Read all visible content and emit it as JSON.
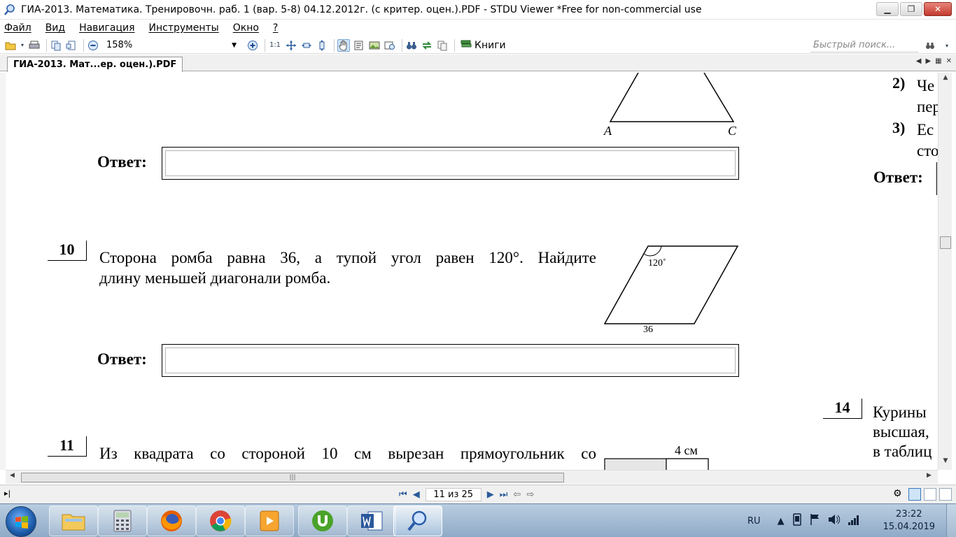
{
  "window": {
    "title": "ГИА-2013. Математика. Тренировочн. раб. 1 (вар. 5-8) 04.12.2012г. (с критер. оцен.).PDF - STDU Viewer *Free for non-commercial use"
  },
  "menu": {
    "items": [
      "Файл",
      "Вид",
      "Навигация",
      "Инструменты",
      "Окно",
      "?"
    ]
  },
  "toolbar": {
    "zoom_value": "158%",
    "actual_size_label": "1:1",
    "books_label": "Книги",
    "search_placeholder": "Быстрый поиск..."
  },
  "tab": {
    "label": "ГИА-2013. Мат...ер. оцен.).PDF"
  },
  "page": {
    "triangle_labels": {
      "a": "A",
      "c": "C"
    },
    "answer_label": "Ответ:",
    "task10": {
      "number": "10",
      "line1": "Сторона ромба равна 36, а тупой угол равен 120°. Найдите",
      "line2": "длину меньшей диагонали ромба.",
      "angle_label": "120˚",
      "side_label": "36"
    },
    "task11": {
      "number": "11",
      "line1": "Из квадрата со стороной 10 см вырезан прямоугольник со",
      "size_label": "4 см"
    },
    "right_column": {
      "item2_num": "2)",
      "item2_line1": "Че",
      "item2_line2": "пер",
      "item3_num": "3)",
      "item3_line1": "Ес",
      "item3_line2": "сто",
      "answer_label": "Ответ:",
      "task14_number": "14",
      "task14_line1": "Курины",
      "task14_line2": "высшая,",
      "task14_line3": "в таблиц"
    }
  },
  "statusbar": {
    "page_indicator": "11 из 25"
  },
  "taskbar": {
    "language": "RU",
    "time": "23:22",
    "date": "15.04.2019"
  }
}
